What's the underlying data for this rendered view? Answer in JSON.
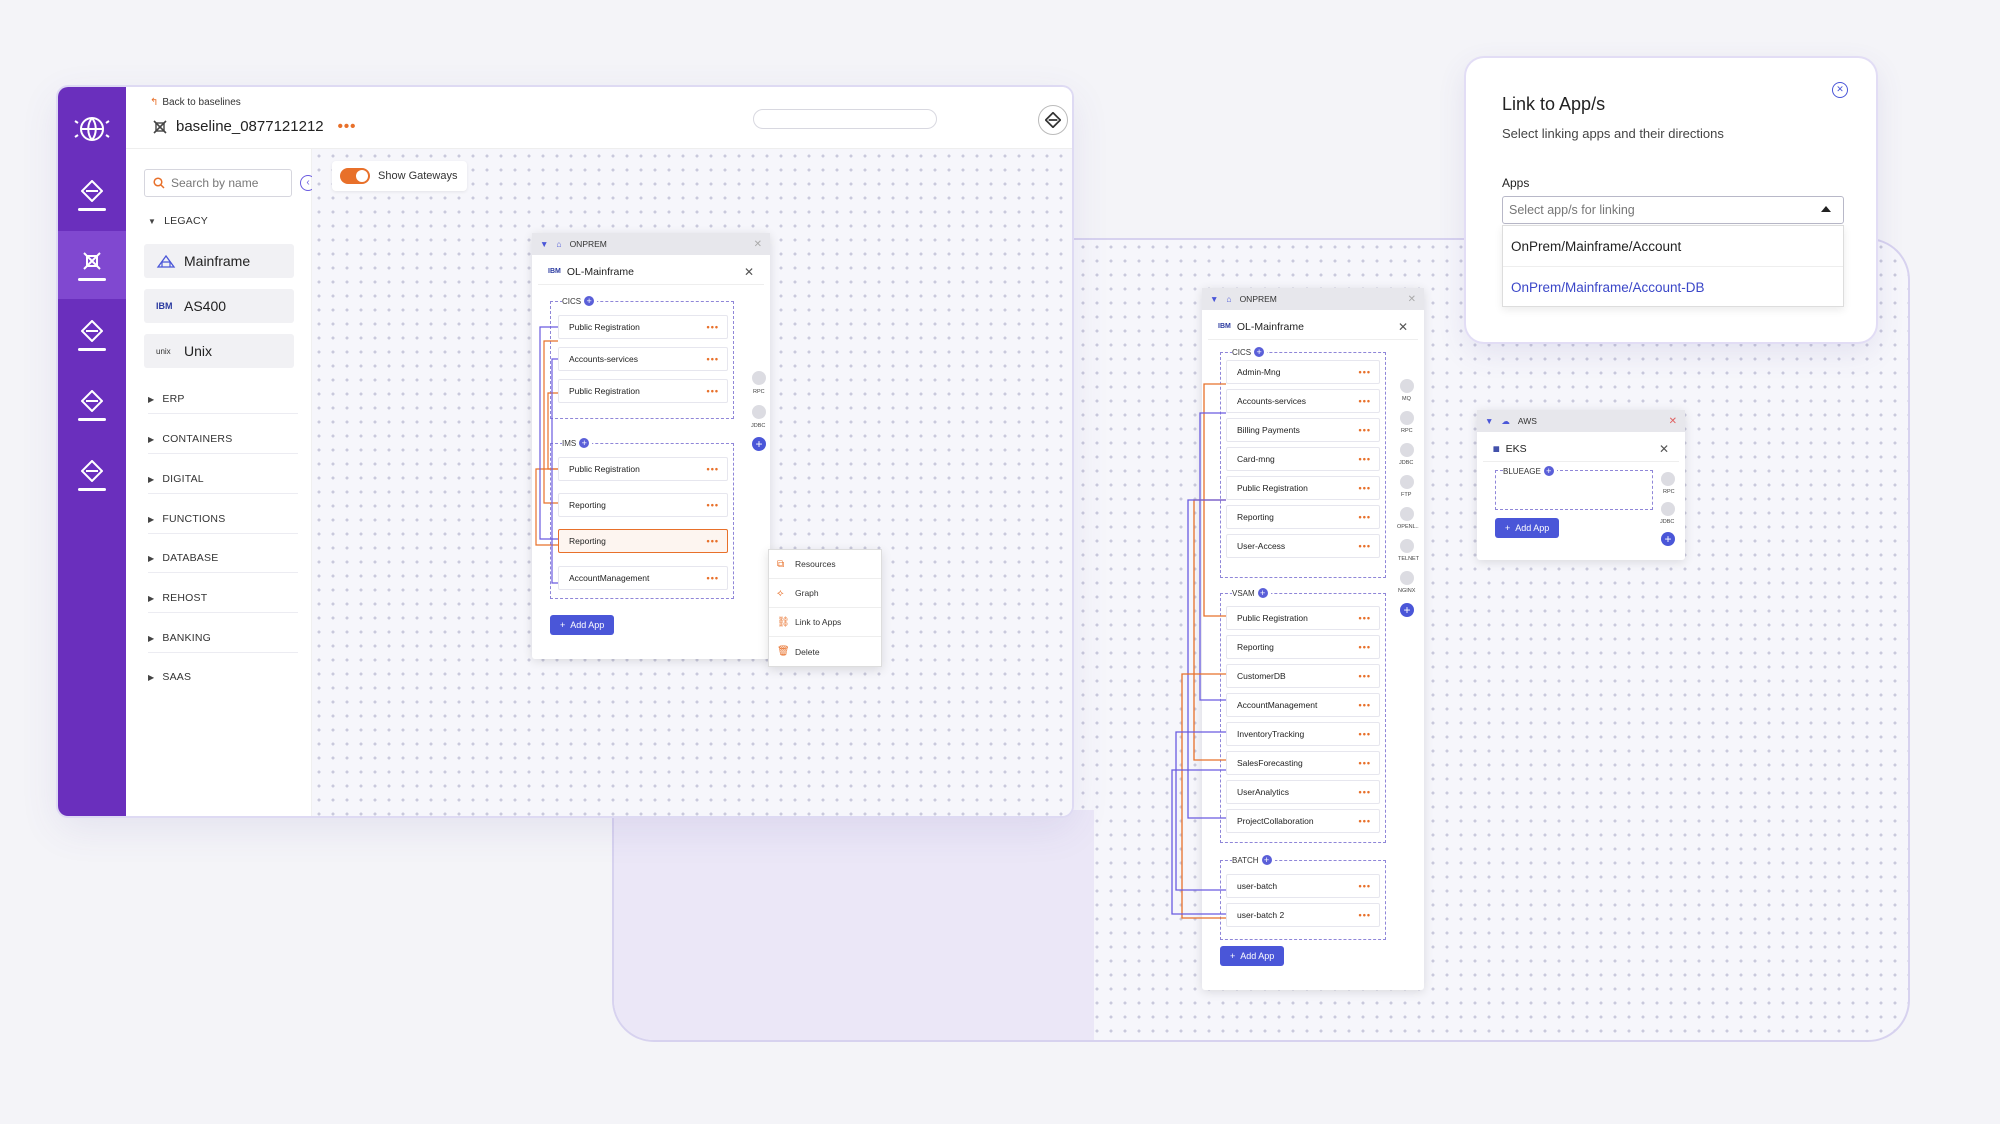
{
  "header": {
    "back_label": "Back to baselines",
    "baseline_title": "baseline_0877121212",
    "more_label": "•••"
  },
  "sidebar": {
    "search_placeholder": "Search by name",
    "show_gateways_label": "Show Gateways",
    "categories": [
      {
        "label": "LEGACY",
        "expanded": true
      },
      {
        "label": "ERP"
      },
      {
        "label": "CONTAINERS"
      },
      {
        "label": "DIGITAL"
      },
      {
        "label": "FUNCTIONS"
      },
      {
        "label": "DATABASE"
      },
      {
        "label": "REHOST"
      },
      {
        "label": "BANKING"
      },
      {
        "label": "SAAS"
      }
    ],
    "legacy_items": [
      {
        "label": "Mainframe",
        "icon": "mainframe-icon"
      },
      {
        "label": "AS400",
        "icon_text": "IBM"
      },
      {
        "label": "Unix",
        "icon_text": "UNIX"
      }
    ]
  },
  "card1": {
    "env": "ONPREM",
    "system": "OL-Mainframe",
    "groups": [
      {
        "label": "CICS",
        "apps": [
          "Public Registration",
          "Accounts-services",
          "Public Registration"
        ]
      },
      {
        "label": "IMS",
        "apps": [
          "Public Registration",
          "Reporting",
          "Reporting",
          "AccountManagement"
        ]
      }
    ],
    "gateways": [
      "RPC",
      "JDBC"
    ],
    "add_app_label": "Add App",
    "menu_dots": "•••"
  },
  "context_menu": {
    "items": [
      {
        "label": "Resources",
        "icon": "resources-icon"
      },
      {
        "label": "Graph",
        "icon": "graph-icon"
      },
      {
        "label": "Link to Apps",
        "icon": "link-icon"
      },
      {
        "label": "Delete",
        "icon": "trash-icon"
      }
    ]
  },
  "card2": {
    "env": "ONPREM",
    "system": "OL-Mainframe",
    "groups": [
      {
        "label": "CICS",
        "apps": [
          "Admin-Mng",
          "Accounts-services",
          "Billing Payments",
          "Card-mng",
          "Public Registration",
          "Reporting",
          "User-Access"
        ]
      },
      {
        "label": "VSAM",
        "apps": [
          "Public Registration",
          "Reporting",
          "CustomerDB",
          "AccountManagement",
          "InventoryTracking",
          "SalesForecasting",
          "UserAnalytics",
          "ProjectCollaboration"
        ]
      },
      {
        "label": "BATCH",
        "apps": [
          "user-batch",
          "user-batch 2"
        ]
      }
    ],
    "gateways": [
      "MQ",
      "RPC",
      "JDBC",
      "FTP",
      "Openl..",
      "Telnet",
      "Nginx"
    ],
    "add_app_label": "Add App"
  },
  "card3": {
    "env": "AWS",
    "system": "EKS",
    "groups": [
      {
        "label": "BLUEAGE",
        "apps": []
      }
    ],
    "gateways": [
      "RPC",
      "JDBC"
    ],
    "add_app_label": "Add App"
  },
  "link_dialog": {
    "title": "Link to App/s",
    "subtitle": "Select linking apps and their directions",
    "apps_label": "Apps",
    "select_placeholder": "Select app/s for linking",
    "options": [
      "OnPrem/Mainframe/Account",
      "OnPrem/Mainframe/Account-DB"
    ]
  },
  "colors": {
    "rail": "#6a2fbd",
    "accent_orange": "#e8702a",
    "accent_blue": "#4a56d8",
    "link_purple": "#6a5be0"
  }
}
